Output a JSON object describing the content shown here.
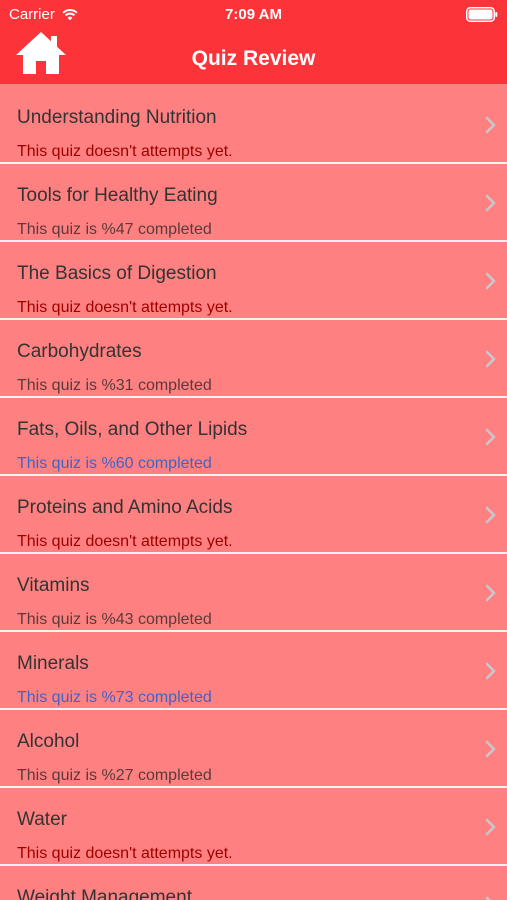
{
  "status_bar": {
    "carrier": "Carrier",
    "time": "7:09 AM"
  },
  "header": {
    "title": "Quiz Review",
    "home_icon": "home-icon"
  },
  "colors": {
    "header_bg": "#fc343a",
    "row_bg": "#ff8080",
    "not_attempted": "#9e0000",
    "in_progress": "#5a3a3a",
    "passed": "#3f63c7"
  },
  "quizzes": [
    {
      "title": "Understanding Nutrition",
      "status": "This quiz doesn't attempts yet.",
      "state": "not_attempted"
    },
    {
      "title": "Tools for Healthy Eating",
      "status": "This quiz is %47 completed",
      "state": "in_progress"
    },
    {
      "title": "The Basics of Digestion",
      "status": "This quiz doesn't attempts yet.",
      "state": "not_attempted"
    },
    {
      "title": "Carbohydrates",
      "status": "This quiz is %31 completed",
      "state": "in_progress"
    },
    {
      "title": "Fats, Oils, and Other Lipids",
      "status": "This quiz is %60 completed",
      "state": "passed"
    },
    {
      "title": "Proteins and Amino Acids",
      "status": "This quiz doesn't attempts yet.",
      "state": "not_attempted"
    },
    {
      "title": "Vitamins",
      "status": "This quiz is %43 completed",
      "state": "in_progress"
    },
    {
      "title": "Minerals",
      "status": "This quiz is %73 completed",
      "state": "passed"
    },
    {
      "title": "Alcohol",
      "status": "This quiz is %27 completed",
      "state": "in_progress"
    },
    {
      "title": "Water",
      "status": "This quiz doesn't attempts yet.",
      "state": "not_attempted"
    },
    {
      "title": "Weight Management",
      "status": "",
      "state": "not_attempted"
    }
  ]
}
